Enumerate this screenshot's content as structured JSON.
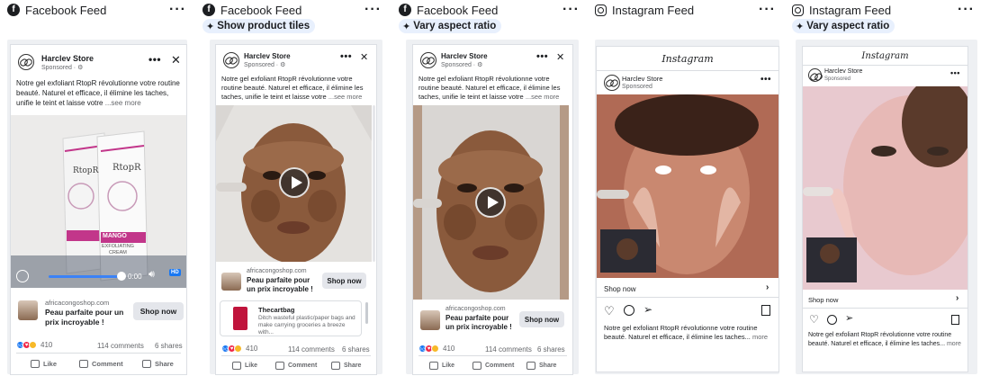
{
  "columns": [
    {
      "platform": "Facebook Feed",
      "icon": "facebook-icon",
      "badge": ""
    },
    {
      "platform": "Facebook Feed",
      "icon": "facebook-icon",
      "badge": "Show product tiles"
    },
    {
      "platform": "Facebook Feed",
      "icon": "facebook-icon",
      "badge": "Vary aspect ratio"
    },
    {
      "platform": "Instagram Feed",
      "icon": "instagram-icon",
      "badge": ""
    },
    {
      "platform": "Instagram Feed",
      "icon": "instagram-icon",
      "badge": "Vary aspect ratio"
    }
  ],
  "ad": {
    "store": "Harclev Store",
    "sponsored": "Sponsored · ⚙",
    "sponsored_ig": "Sponsored",
    "text_a": "Notre gel exfoliant RtopR révolutionne votre routine beauté. Naturel et efficace, il élimine les taches, unifie le teint et laisse votre",
    "see_more": "...see more",
    "domain": "africacongoshop.com",
    "headline": "Peau parfaite pour un prix incroyable !",
    "cta": "Shop now",
    "reaction_count": "410",
    "comments": "114 comments",
    "shares": "6 shares",
    "like": "Like",
    "comment": "Comment",
    "share": "Share",
    "video_time": "0:00",
    "hd": "HD"
  },
  "product": {
    "brand": "RtopR",
    "name_1": "MANGO",
    "name_2": "EXFOLIATING",
    "name_3": "CREAM"
  },
  "tile2": {
    "title": "Thecartbag",
    "text": "Ditch wasteful plastic/paper bags and make carrying groceries a breeze with..."
  },
  "instagram": {
    "logo": "Instagram",
    "shop": "Shop now",
    "caption": "Notre gel exfoliant RtopR révolutionne votre routine beauté. Naturel et efficace, il élimine les taches...",
    "more": "more"
  },
  "colors": {
    "badge_bg": "#e8f0fd",
    "fb_blue": "#1877f2",
    "card_bg": "#eef0f3"
  }
}
